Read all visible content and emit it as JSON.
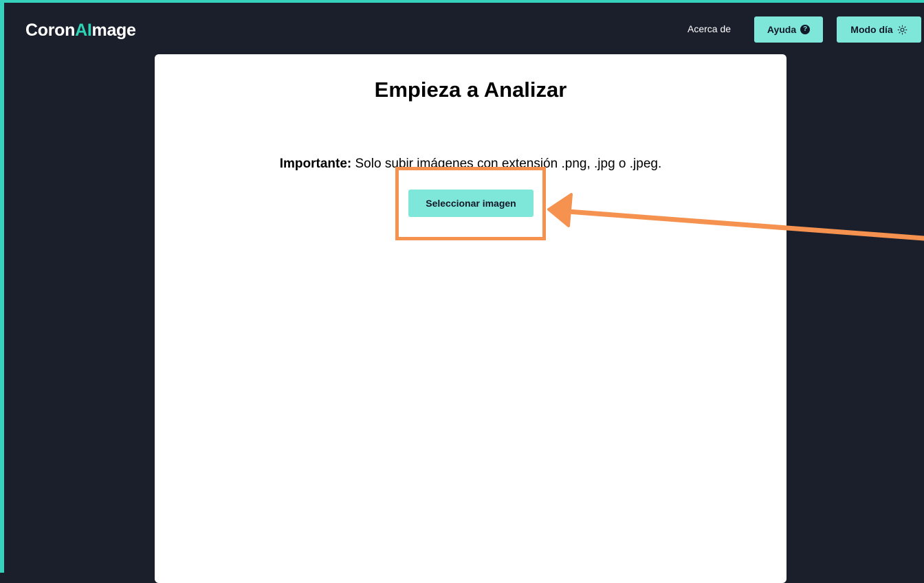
{
  "header": {
    "logo_prefix": "Coron",
    "logo_accent": "AI",
    "logo_suffix": "mage",
    "nav_about": "Acerca de",
    "help_button_label": "Ayuda",
    "help_icon_glyph": "?",
    "day_mode_button_label": "Modo día"
  },
  "main": {
    "title": "Empieza a Analizar",
    "notice_label": "Importante:",
    "notice_text": " Solo subir imágenes con extensión .png, .jpg o .jpeg.",
    "select_button_label": "Seleccionar imagen"
  },
  "icons": {
    "help": "question-circle-icon",
    "day_mode": "sun-icon"
  },
  "colors": {
    "background": "#1a1f2b",
    "accent": "#2ed3b6",
    "button": "#7fe6da",
    "frame": "#36d0bd",
    "annotation": "#f5924f"
  }
}
